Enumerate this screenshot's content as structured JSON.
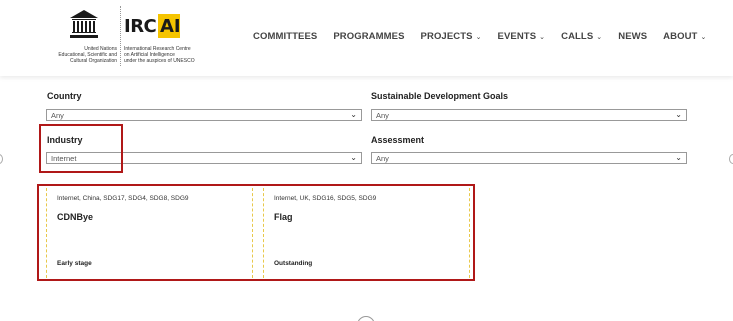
{
  "header": {
    "unesco_label": "UNESCO",
    "unesco_text": [
      "United Nations",
      "Educational, Scientific and",
      "Cultural Organization"
    ],
    "ircai_text": [
      "International Research Centre",
      "on Artificial Intelligence",
      "under the auspices of UNESCO"
    ],
    "ircai_logo": {
      "irc": "IRC",
      "ai": "AI"
    },
    "nav": [
      {
        "label": "COMMITTEES",
        "dropdown": false
      },
      {
        "label": "PROGRAMMES",
        "dropdown": false
      },
      {
        "label": "PROJECTS",
        "dropdown": true
      },
      {
        "label": "EVENTS",
        "dropdown": true
      },
      {
        "label": "CALLS",
        "dropdown": true
      },
      {
        "label": "NEWS",
        "dropdown": false
      },
      {
        "label": "ABOUT",
        "dropdown": true
      }
    ]
  },
  "filters": {
    "country": {
      "label": "Country",
      "value": "Any"
    },
    "sdg": {
      "label": "Sustainable Development Goals",
      "value": "Any"
    },
    "industry": {
      "label": "Industry",
      "value": "Internet"
    },
    "assessment": {
      "label": "Assessment",
      "value": "Any"
    }
  },
  "cards": [
    {
      "tags": "Internet, China, SDG17, SDG4, SDG8, SDG9",
      "title": "CDNBye",
      "stage": "Early stage"
    },
    {
      "tags": "Internet, UK, SDG16, SDG5, SDG9",
      "title": "Flag",
      "stage": "Outstanding"
    }
  ],
  "colors": {
    "accent": "#f5c400",
    "highlight": "#b01818",
    "card_border": "#e8c84a"
  },
  "icons": {
    "caret": "chevron-down-icon"
  }
}
